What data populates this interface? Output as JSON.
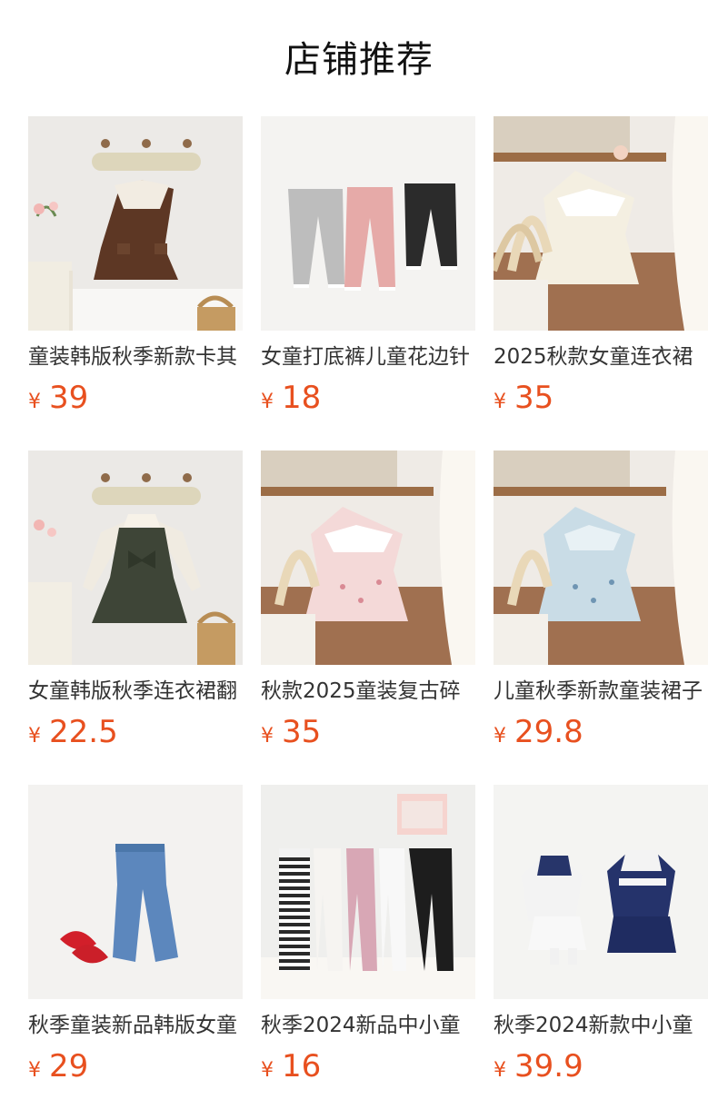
{
  "page": {
    "title": "店铺推荐"
  },
  "products": [
    {
      "title": "童装韩版秋季新款卡其",
      "currency": "¥",
      "price": "39",
      "image_icon": "brown-dress-on-hook-image"
    },
    {
      "title": "女童打底裤儿童花边针",
      "currency": "¥",
      "price": "18",
      "image_icon": "three-leggings-image"
    },
    {
      "title": "2025秋款女童连衣裙",
      "currency": "¥",
      "price": "35",
      "image_icon": "cream-striped-dress-image"
    },
    {
      "title": "女童韩版秋季连衣裙翻",
      "currency": "¥",
      "price": "22.5",
      "image_icon": "green-bow-dress-image"
    },
    {
      "title": "秋款2025童装复古碎",
      "currency": "¥",
      "price": "35",
      "image_icon": "pink-floral-dress-image"
    },
    {
      "title": "儿童秋季新款童装裙子",
      "currency": "¥",
      "price": "29.8",
      "image_icon": "blue-floral-dress-image"
    },
    {
      "title": "秋季童装新品韩版女童",
      "currency": "¥",
      "price": "29",
      "image_icon": "denim-flare-jeans-image"
    },
    {
      "title": "秋季2024新品中小童",
      "currency": "¥",
      "price": "16",
      "image_icon": "striped-leggings-set-image"
    },
    {
      "title": "秋季2024新款中小童",
      "currency": "¥",
      "price": "39.9",
      "image_icon": "navy-sailor-set-image"
    }
  ],
  "colors": {
    "price": "#e8501f",
    "title": "#333333"
  }
}
